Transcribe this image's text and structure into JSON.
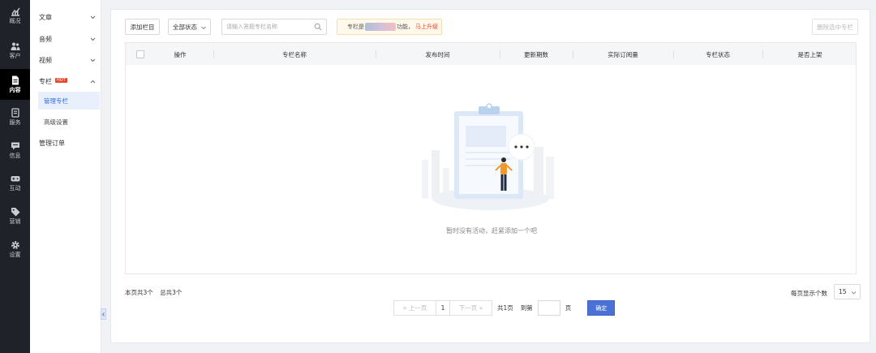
{
  "nav_rail": {
    "items": [
      {
        "label": "概况",
        "icon": "chart-icon"
      },
      {
        "label": "客户",
        "icon": "users-icon"
      },
      {
        "label": "内容",
        "icon": "document-icon",
        "active": true
      },
      {
        "label": "服务",
        "icon": "service-icon"
      },
      {
        "label": "信息",
        "icon": "message-icon"
      },
      {
        "label": "互动",
        "icon": "gamepad-icon"
      },
      {
        "label": "营销",
        "icon": "tag-icon"
      },
      {
        "label": "设置",
        "icon": "gear-icon"
      }
    ]
  },
  "submenu": {
    "items": [
      {
        "label": "文章"
      },
      {
        "label": "音频"
      },
      {
        "label": "视频"
      },
      {
        "label": "专栏",
        "badge": "HOT"
      },
      {
        "label": "管理专栏"
      },
      {
        "label": "高级设置"
      },
      {
        "label": "管理订单"
      }
    ]
  },
  "toolbar": {
    "add_label": "添加栏目",
    "status_select": "全部状态",
    "search_placeholder": "请输入答题专栏名称",
    "notice_prefix": "专栏是",
    "notice_suffix": "功能，",
    "notice_link": "马上升级",
    "delete_label": "删除选中专栏"
  },
  "table": {
    "columns": [
      "操作",
      "专栏名称",
      "发布时间",
      "更新期数",
      "实际订阅量",
      "专栏状态",
      "是否上架"
    ],
    "rows": [],
    "empty_text": "暂时没有活动，赶紧添加一个吧"
  },
  "footer": {
    "page_count": "本页共3个",
    "total_count": "总共3个",
    "prev_label": "上一页",
    "current_page": "1",
    "next_label": "下一页",
    "total_pages": "共1页",
    "jump_label": "到第",
    "jump_value": "",
    "page_unit": "页",
    "confirm_label": "确定",
    "per_page_label": "每页显示个数",
    "per_page_value": "15"
  },
  "colors": {
    "rail_bg": "#1f2329",
    "accent": "#4a72d6",
    "hot_badge": "#e8452f",
    "upgrade_link": "#e8452f"
  }
}
